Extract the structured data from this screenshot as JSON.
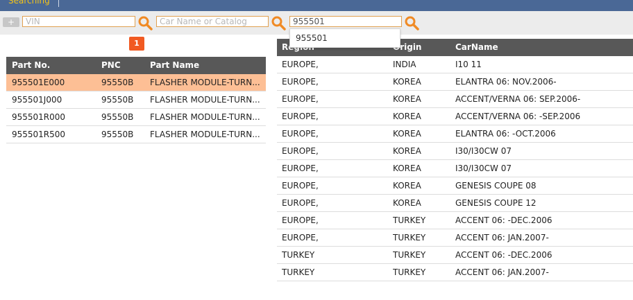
{
  "topbar": {
    "tab_label": "Searching"
  },
  "search": {
    "add_label": "+",
    "vin_placeholder": "VIN",
    "car_placeholder": "Car Name or Catalog",
    "part_value": "955501",
    "suggestion": "955501"
  },
  "pagination": {
    "current_page": "1"
  },
  "parts_table": {
    "headers": {
      "part_no": "Part No.",
      "pnc": "PNC",
      "part_name": "Part Name"
    },
    "rows": [
      {
        "part_no": "955501E000",
        "pnc": "95550B",
        "part_name": "FLASHER MODULE-TURN..."
      },
      {
        "part_no": "955501J000",
        "pnc": "95550B",
        "part_name": "FLASHER MODULE-TURN..."
      },
      {
        "part_no": "955501R000",
        "pnc": "95550B",
        "part_name": "FLASHER MODULE-TURN..."
      },
      {
        "part_no": "955501R500",
        "pnc": "95550B",
        "part_name": "FLASHER MODULE-TURN..."
      }
    ]
  },
  "cars_table": {
    "headers": {
      "region": "Region",
      "origin": "Origin",
      "car_name": "CarName"
    },
    "rows": [
      {
        "region": "EUROPE,",
        "origin": "INDIA",
        "car_name": "I10 11"
      },
      {
        "region": "EUROPE,",
        "origin": "KOREA",
        "car_name": "ELANTRA 06: NOV.2006-"
      },
      {
        "region": "EUROPE,",
        "origin": "KOREA",
        "car_name": "ACCENT/VERNA 06: SEP.2006-"
      },
      {
        "region": "EUROPE,",
        "origin": "KOREA",
        "car_name": "ACCENT/VERNA 06: -SEP.2006"
      },
      {
        "region": "EUROPE,",
        "origin": "KOREA",
        "car_name": "ELANTRA 06: -OCT.2006"
      },
      {
        "region": "EUROPE,",
        "origin": "KOREA",
        "car_name": "I30/I30CW 07"
      },
      {
        "region": "EUROPE,",
        "origin": "KOREA",
        "car_name": "I30/I30CW 07"
      },
      {
        "region": "EUROPE,",
        "origin": "KOREA",
        "car_name": "GENESIS COUPE 08"
      },
      {
        "region": "EUROPE,",
        "origin": "KOREA",
        "car_name": "GENESIS COUPE 12"
      },
      {
        "region": "EUROPE,",
        "origin": "TURKEY",
        "car_name": "ACCENT 06: -DEC.2006"
      },
      {
        "region": "EUROPE,",
        "origin": "TURKEY",
        "car_name": "ACCENT 06: JAN.2007-"
      },
      {
        "region": "TURKEY",
        "origin": "TURKEY",
        "car_name": "ACCENT 06: -DEC.2006"
      },
      {
        "region": "TURKEY",
        "origin": "TURKEY",
        "car_name": "ACCENT 06: JAN.2007-"
      }
    ]
  },
  "colors": {
    "accent": "#f15a22",
    "selected_row": "#fdbf95",
    "header_bg": "#585858",
    "topbar": "#4a6896"
  },
  "icons": {
    "search": "search-icon"
  }
}
